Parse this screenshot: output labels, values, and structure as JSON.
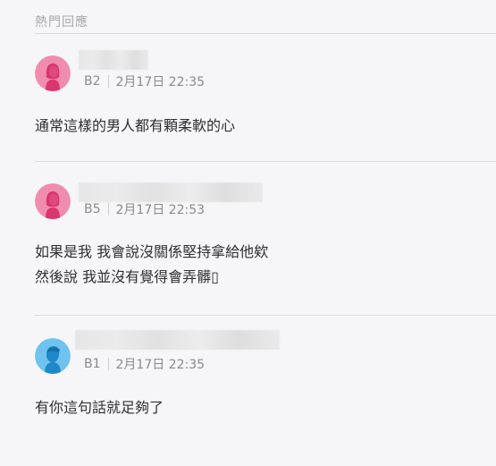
{
  "section": {
    "title": "熱門回應"
  },
  "comments": [
    {
      "floor": "B2",
      "time": "2月17日 22:35",
      "avatar": "female-avatar-icon",
      "avatar_color": "#f08cae",
      "text": "通常這樣的男人都有顆柔軟的心"
    },
    {
      "floor": "B5",
      "time": "2月17日 22:53",
      "avatar": "female-avatar-icon",
      "avatar_color": "#f08cae",
      "text": "如果是我 我會說沒關係堅持拿給他欸\n然後說 我並沒有覺得會弄髒▯"
    },
    {
      "floor": "B1",
      "time": "2月17日 22:35",
      "avatar": "male-avatar-icon",
      "avatar_color": "#6fc3ee",
      "text": "有你這句話就足夠了"
    }
  ]
}
